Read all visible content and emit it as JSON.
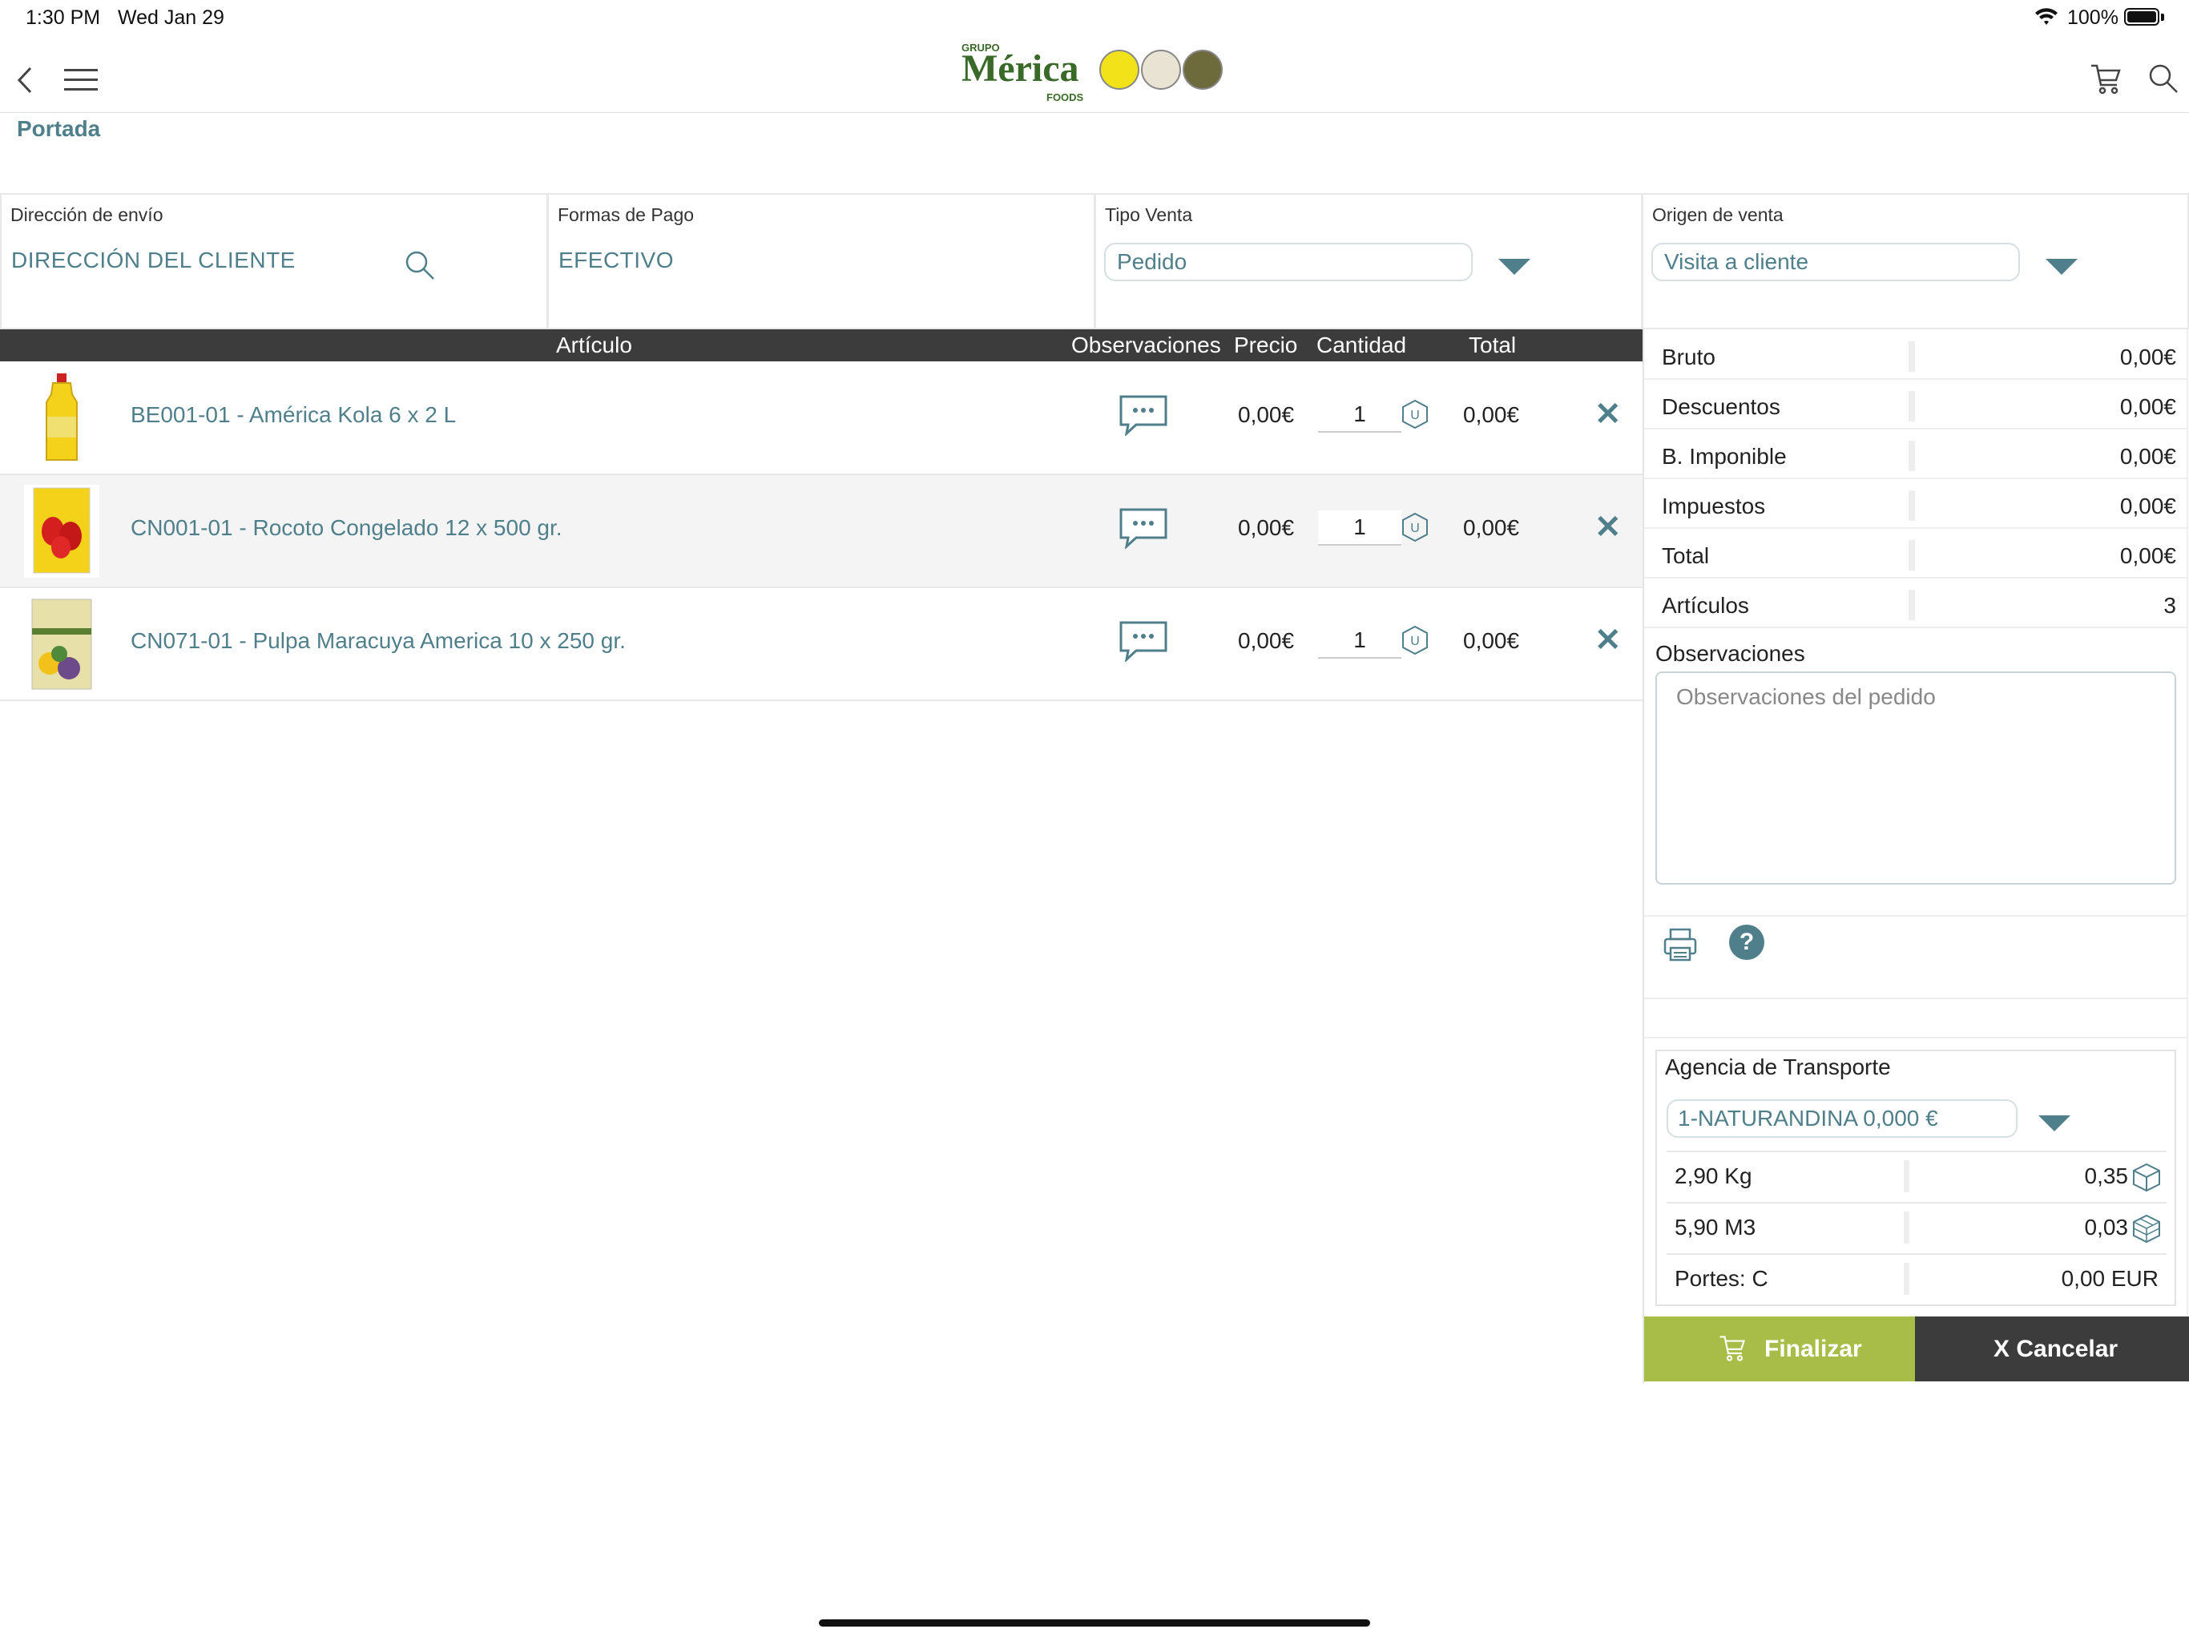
{
  "status_bar": {
    "time": "1:30 PM",
    "date": "Wed Jan 29",
    "battery": "100%"
  },
  "header": {
    "logo": {
      "small_top": "GRUPO",
      "main": "Mérica",
      "small_bottom": "FOODS"
    },
    "breadcrumb": "Portada",
    "icons": [
      "back-chevron-icon",
      "hamburger-menu-icon",
      "cart-icon",
      "search-icon"
    ]
  },
  "fields": {
    "shipping": {
      "label": "Dirección de envío",
      "value": "DIRECCIÓN DEL CLIENTE"
    },
    "payment": {
      "label": "Formas de Pago",
      "value": "EFECTIVO"
    },
    "sale_type": {
      "label": "Tipo Venta",
      "value": "Pedido"
    },
    "sale_origin": {
      "label": "Origen de venta",
      "value": "Visita a cliente"
    }
  },
  "table": {
    "headers": {
      "article": "Artículo",
      "observations": "Observaciones",
      "price": "Precio",
      "quantity": "Cantidad",
      "total": "Total"
    },
    "rows": [
      {
        "name": "BE001-01 - América Kola 6 x 2 L",
        "price": "0,00€",
        "qty": "1",
        "unit": "U",
        "total": "0,00€"
      },
      {
        "name": "CN001-01 - Rocoto Congelado 12 x 500 gr.",
        "price": "0,00€",
        "qty": "1",
        "unit": "U",
        "total": "0,00€"
      },
      {
        "name": "CN071-01 - Pulpa Maracuya America 10 x 250 gr.",
        "price": "0,00€",
        "qty": "1",
        "unit": "U",
        "total": "0,00€"
      }
    ]
  },
  "summary": {
    "rows": [
      {
        "label": "Bruto",
        "value": "0,00€"
      },
      {
        "label": "Descuentos",
        "value": "0,00€"
      },
      {
        "label": "B. Imponible",
        "value": "0,00€"
      },
      {
        "label": "Impuestos",
        "value": "0,00€"
      },
      {
        "label": "Total",
        "value": "0,00€"
      },
      {
        "label": "Artículos",
        "value": "3"
      }
    ],
    "observations_label": "Observaciones",
    "observations_placeholder": "Observaciones del pedido"
  },
  "transport": {
    "label": "Agencia de Transporte",
    "selected": "1-NATURANDINA 0,000 €",
    "rows": [
      {
        "label": "2,90 Kg",
        "value": "0,35"
      },
      {
        "label": "5,90 M3",
        "value": "0,03"
      },
      {
        "label": "Portes: C",
        "value": "0,00 EUR"
      }
    ]
  },
  "actions": {
    "finish": "Finalizar",
    "cancel": "X Cancelar"
  },
  "colors": {
    "accent": "#4f7f8b",
    "finish_button": "#a8bc48",
    "dark": "#3c3c3c"
  }
}
